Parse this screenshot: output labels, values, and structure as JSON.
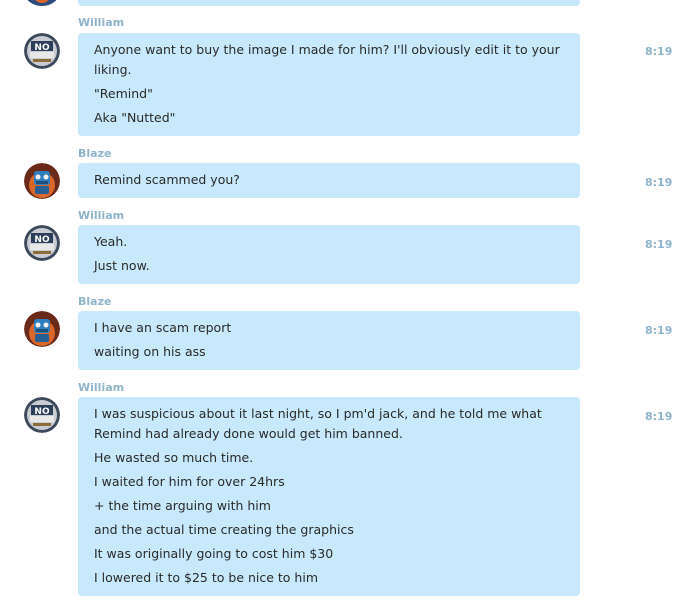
{
  "conversation": {
    "messages": [
      {
        "sender": "William",
        "avatar": "no-sign-avatar",
        "time": "8:19 P",
        "lines": [
          "Anyone want to buy the image I made for him? I'll obviously edit it to your liking.",
          "\"Remind\"",
          "Aka \"Nutted\""
        ]
      },
      {
        "sender": "Blaze",
        "avatar": "robot-avatar",
        "time": "8:19 P",
        "lines": [
          "Remind scammed you?"
        ]
      },
      {
        "sender": "William",
        "avatar": "no-sign-avatar",
        "time": "8:19 P",
        "lines": [
          "Yeah.",
          "Just now."
        ]
      },
      {
        "sender": "Blaze",
        "avatar": "robot-avatar",
        "time": "8:19 P",
        "lines": [
          "I have an scam report",
          "waiting on his ass"
        ]
      },
      {
        "sender": "William",
        "avatar": "no-sign-avatar",
        "time": "8:19 P",
        "lines": [
          "I was suspicious about it last night, so I pm'd jack, and he told me what Remind had already done would get him banned.",
          "He wasted so much time.",
          "I waited for him for over 24hrs",
          "+ the time arguing with him",
          "and the actual time creating the graphics",
          "It was originally going to cost him $30",
          "I lowered it to $25 to be nice to him"
        ]
      }
    ]
  },
  "colors": {
    "bubble": "#c7e9fb",
    "meta_text": "#8fb3c9",
    "message_text": "#2a2a2a"
  }
}
